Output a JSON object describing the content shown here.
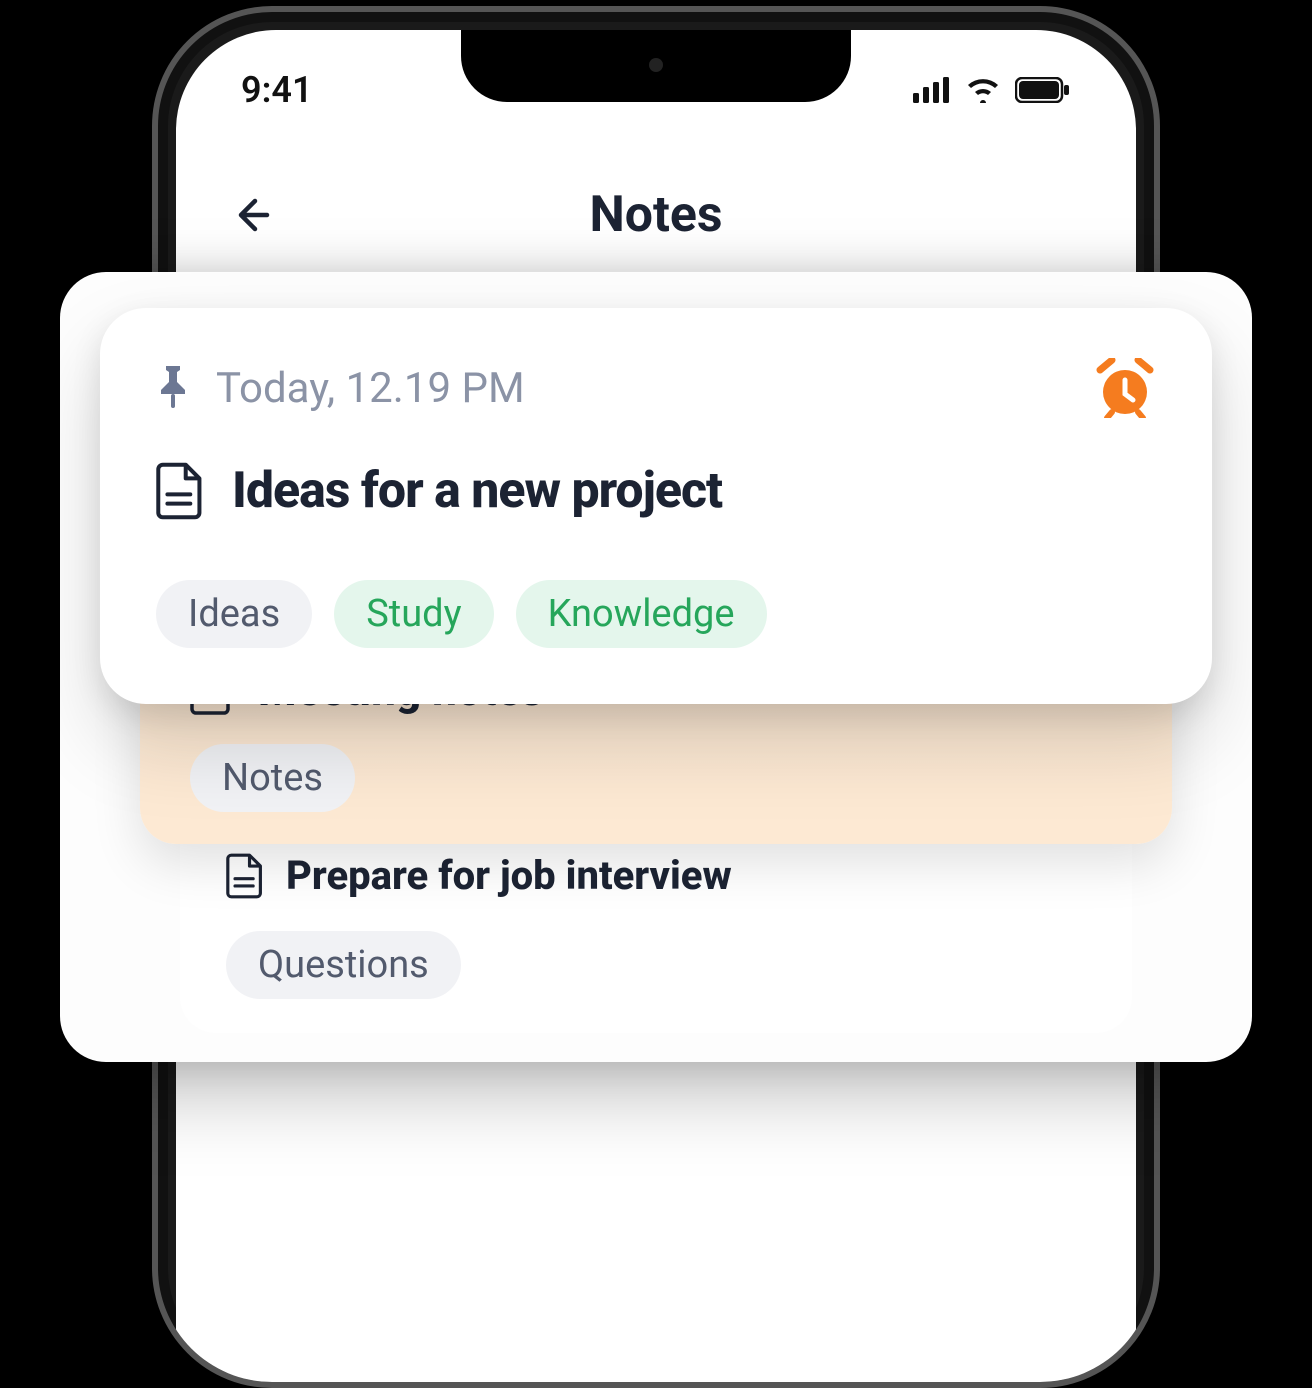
{
  "status": {
    "time": "9:41"
  },
  "header": {
    "title": "Notes"
  },
  "card": {
    "date": "Today, 12.19 PM",
    "title": "Ideas for a new project",
    "tags": {
      "t0": "Ideas",
      "t1": "Study",
      "t2": "Knowledge"
    }
  },
  "meeting": {
    "title": "Meeting notes",
    "tag": "Notes"
  },
  "prepare": {
    "title": "Prepare for job interview",
    "tag": "Questions"
  }
}
